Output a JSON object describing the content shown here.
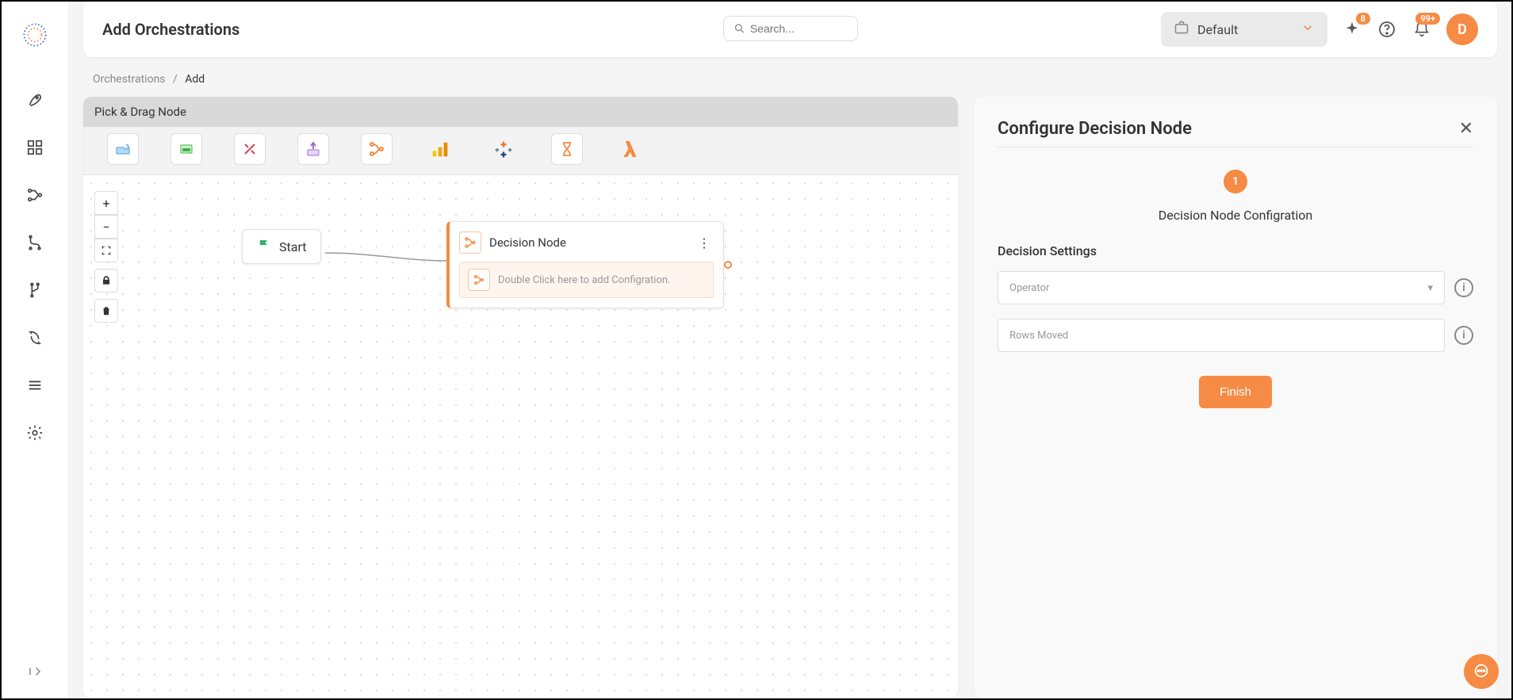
{
  "header": {
    "title": "Add Orchestrations",
    "search_placeholder": "Search...",
    "workspace_label": "Default",
    "sparkle_badge": "8",
    "bell_badge": "99+",
    "avatar_initial": "D"
  },
  "breadcrumb": {
    "root": "Orchestrations",
    "current": "Add"
  },
  "palette": {
    "header": "Pick & Drag Node"
  },
  "canvas": {
    "start_label": "Start",
    "decision_title": "Decision Node",
    "decision_hint": "Double Click here to add Configration."
  },
  "config": {
    "title": "Configure Decision Node",
    "step_number": "1",
    "step_label": "Decision Node Configration",
    "section_label": "Decision Settings",
    "operator_placeholder": "Operator",
    "rows_placeholder": "Rows Moved",
    "finish_label": "Finish"
  }
}
